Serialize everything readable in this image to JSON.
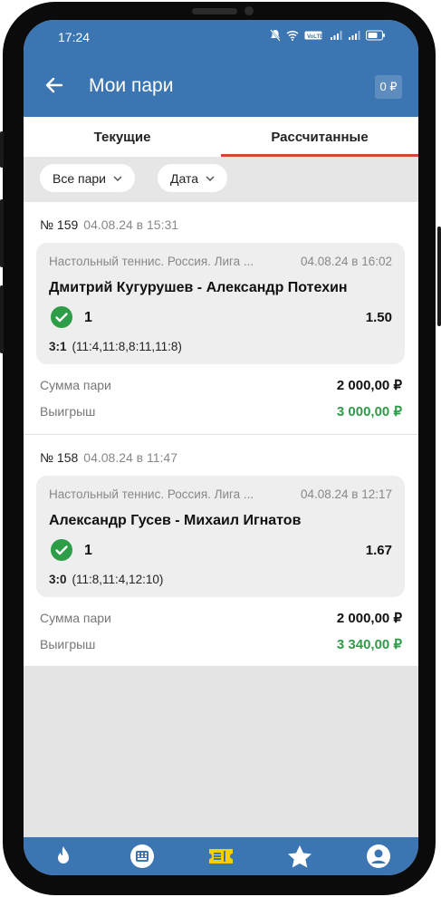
{
  "status": {
    "time": "17:24"
  },
  "header": {
    "title": "Мои пари",
    "balance": "0 ₽"
  },
  "tabs": [
    {
      "label": "Текущие"
    },
    {
      "label": "Рассчитанные"
    }
  ],
  "filters": [
    {
      "label": "Все пари"
    },
    {
      "label": "Дата"
    }
  ],
  "bets": [
    {
      "number": "№ 159",
      "placed": "04.08.24 в 15:31",
      "league": "Настольный теннис. Россия. Лига ...",
      "event_date": "04.08.24 в 16:02",
      "teams": "Дмитрий Кугурушев - Александр Потехин",
      "outcome": "1",
      "coefficient": "1.50",
      "score": "3:1",
      "sets": "(11:4,11:8,8:11,11:8)",
      "stake_label": "Сумма пари",
      "stake": "2 000,00 ₽",
      "win_label": "Выигрыш",
      "win": "3 000,00 ₽"
    },
    {
      "number": "№ 158",
      "placed": "04.08.24 в 11:47",
      "league": "Настольный теннис. Россия. Лига ...",
      "event_date": "04.08.24 в 12:17",
      "teams": "Александр Гусев - Михаил Игнатов",
      "outcome": "1",
      "coefficient": "1.67",
      "score": "3:0",
      "sets": "(11:8,11:4,12:10)",
      "stake_label": "Сумма пари",
      "stake": "2 000,00 ₽",
      "win_label": "Выигрыш",
      "win": "3 340,00 ₽"
    }
  ],
  "colors": {
    "header": "#3c76b2",
    "tab_accent": "#d8433c",
    "win": "#2e9d47",
    "nav_active": "#f5d000"
  }
}
